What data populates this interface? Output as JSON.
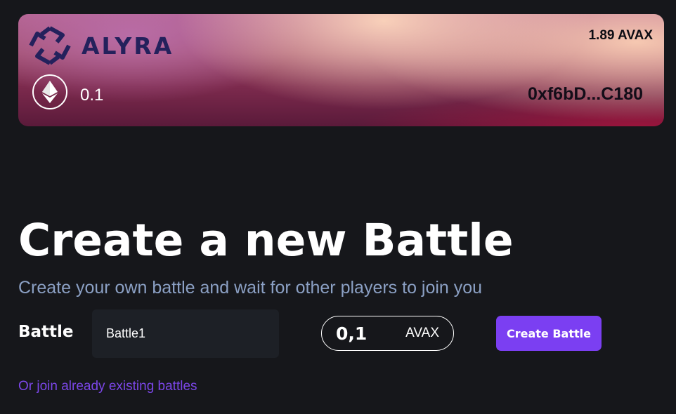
{
  "header": {
    "logo": {
      "text": "ALYRA",
      "icon": "alyra-logo-icon"
    },
    "eth_icon": "ethereum-icon",
    "eth_amount": "0.1",
    "balance": "1.89 AVAX",
    "address": "0xf6bD...C180"
  },
  "main": {
    "title": "Create a new Battle",
    "subtitle": "Create your own battle and wait for other players to join you",
    "battle_label": "Battle",
    "battle_input_value": "Battle1",
    "amount_value": "0,1",
    "amount_unit": "AVAX",
    "create_button_label": "Create Battle",
    "join_link": "Or join already existing battles"
  },
  "colors": {
    "background": "#16171b",
    "accent": "#7b3ff2",
    "subtitle": "#8ba0c4",
    "link": "#7b46e8",
    "logo": "#24215c"
  }
}
